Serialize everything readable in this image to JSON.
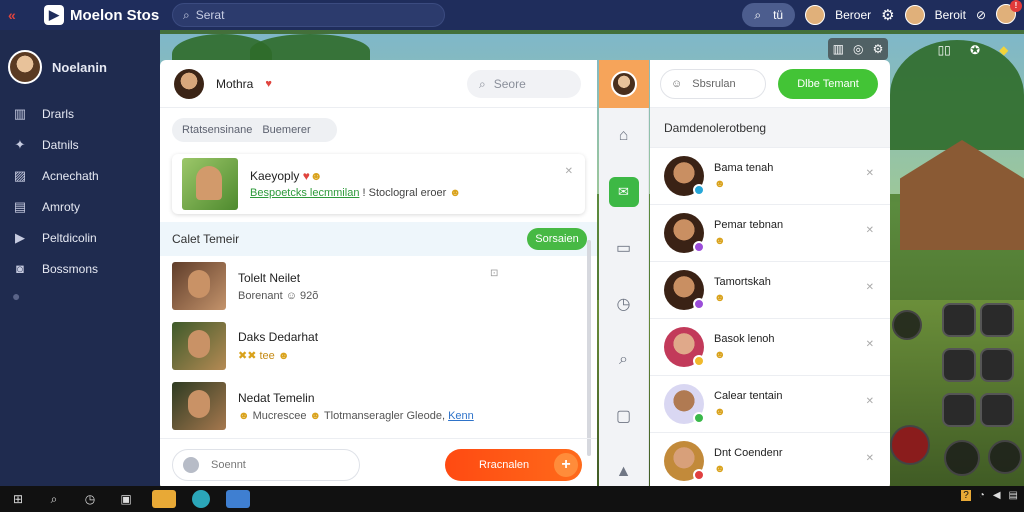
{
  "app": {
    "title": "Moelon Stos",
    "search_placeholder": "Serat"
  },
  "topbar": {
    "pill_text": "tü",
    "user1": "Beroer",
    "user2": "Beroit"
  },
  "sidebar": {
    "user": "Noelanin",
    "items": [
      {
        "label": "Drarls",
        "icon": "chart-icon"
      },
      {
        "label": "Datnils",
        "icon": "pin-icon"
      },
      {
        "label": "Acnechath",
        "icon": "image-icon"
      },
      {
        "label": "Amroty",
        "icon": "book-icon"
      },
      {
        "label": "Peltdicolin",
        "icon": "play-icon"
      },
      {
        "label": "Bossmons",
        "icon": "camera-icon"
      }
    ]
  },
  "chat": {
    "header_name": "Mothra",
    "search_placeholder": "Seore",
    "filters": [
      "Rtatsensinane",
      "Buemerer"
    ],
    "featured": {
      "title": "Kaeyoply",
      "link": "Bespoetcks lecmmilan",
      "rest": "Stoclogral eroer"
    },
    "section_title": "Calet Temeir",
    "section_button": "Sorsaien",
    "messages": [
      {
        "name": "Tolelt Neilet",
        "preview": "Borenant",
        "extra": "92õ"
      },
      {
        "name": "Daks Dedarhat",
        "preview": "tee"
      },
      {
        "name": "Nedat Temelin",
        "preview": "Mucrescee",
        "preview2": "Tlotmanseragler Gleode",
        "link": "Kenn"
      }
    ],
    "input_placeholder": "Soennt",
    "send_label": "Rracnalen"
  },
  "contacts": {
    "search_placeholder": "Sbsrulan",
    "button": "Dlbe Temant",
    "title": "Damdenolerotbeng",
    "list": [
      {
        "name": "Bama tenah",
        "status": "#27a7d8"
      },
      {
        "name": "Pemar tebnan",
        "status": "#9b4dd9"
      },
      {
        "name": "Tamortskah",
        "status": "#9b4dd9"
      },
      {
        "name": "Basok lenoh",
        "status": "#f0b92b"
      },
      {
        "name": "Calear tentain",
        "status": "#3ab84a"
      },
      {
        "name": "Dnt Coendenr",
        "status": "#e04040"
      }
    ]
  },
  "colors": {
    "accent_green": "#43c436",
    "accent_orange": "#ff5a16",
    "nav_bg": "#1f2b4f"
  }
}
